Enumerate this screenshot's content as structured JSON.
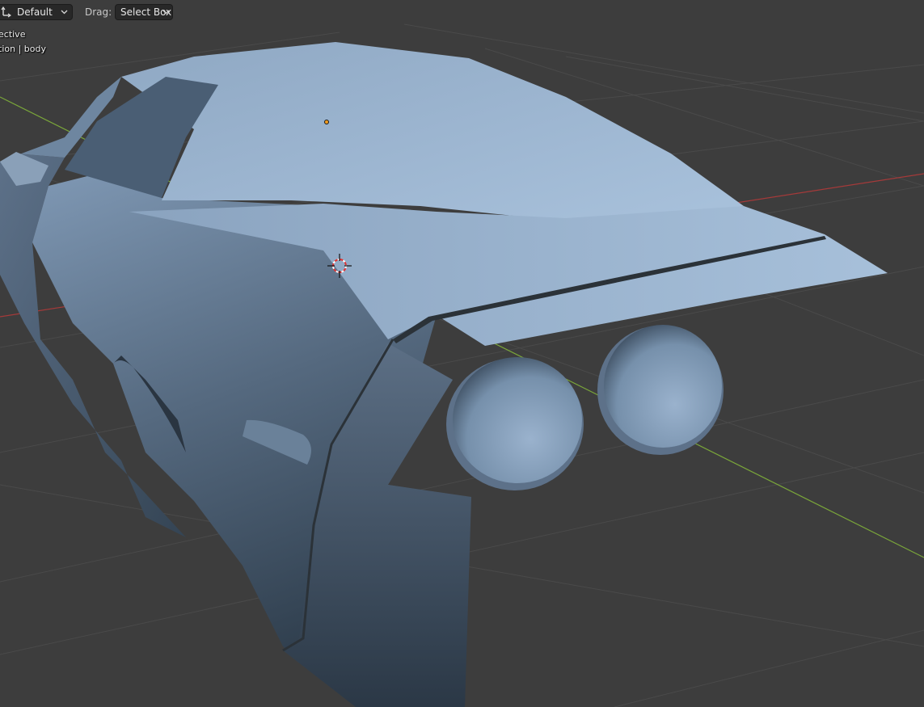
{
  "header": {
    "transform_orientation": {
      "icon": "transform-orientation-icon",
      "value": "Default"
    },
    "drag": {
      "label": "Drag:",
      "value": "Select Box"
    }
  },
  "overlay": {
    "view_name": "ective",
    "collection_object": "tion | body"
  },
  "colors": {
    "background": "#3d3d3d",
    "grid_line": "#4a4a4a",
    "x_axis": "#a53a3a",
    "y_axis": "#7aa63a",
    "mesh_light": "#a9c2dc",
    "mesh_mid": "#7f98b4",
    "mesh_dark": "#2f3e4d",
    "origin": "#f29c1f"
  },
  "scene": {
    "object": "body",
    "cursor_icon": "3d-cursor-icon",
    "origin_icon": "object-origin-icon"
  }
}
